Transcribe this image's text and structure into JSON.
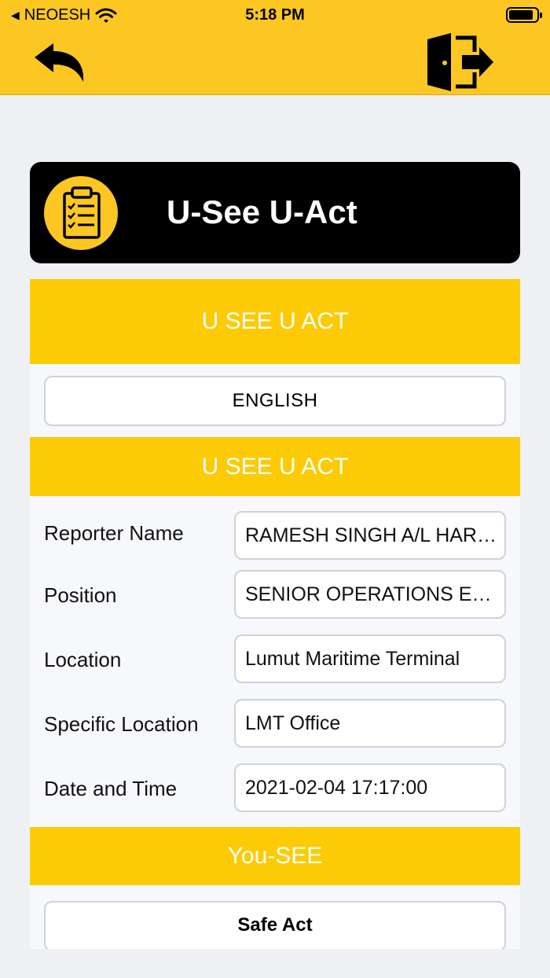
{
  "status_bar": {
    "carrier": "NEOESH",
    "time": "5:18 PM"
  },
  "nav": {
    "back_icon": "back-arrow-icon",
    "exit_icon": "logout-door-icon"
  },
  "header": {
    "title": "U-See U-Act",
    "icon": "clipboard-checklist-icon"
  },
  "form": {
    "section_title": "U SEE U ACT",
    "language_button": "ENGLISH",
    "subsection_title": "U SEE U ACT",
    "fields": [
      {
        "label": "Reporter Name",
        "value": "RAMESH SINGH A/L HARBANS SINGH"
      },
      {
        "label": "Position",
        "value": "SENIOR OPERATIONS EXECUTIVE"
      },
      {
        "label": "Location",
        "value": "Lumut Maritime Terminal"
      },
      {
        "label": "Specific Location",
        "value": "LMT Office"
      },
      {
        "label": "Date and Time",
        "value": "2021-02-04 17:17:00"
      }
    ],
    "you_see_title": "You-SEE",
    "safe_act_button": "Safe Act"
  },
  "colors": {
    "accent": "#fcc722",
    "band": "#fccb05",
    "header_bg": "#000000"
  }
}
